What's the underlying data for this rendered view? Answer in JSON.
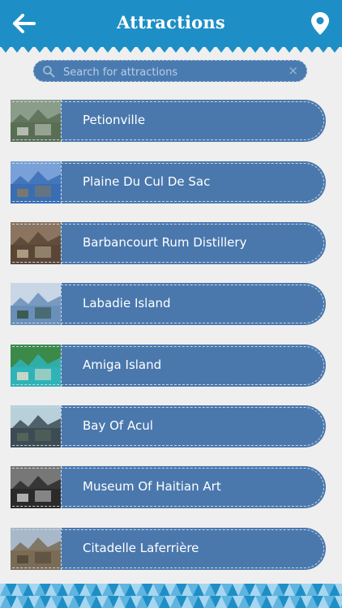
{
  "header": {
    "title": "Attractions",
    "back_icon": "arrow-left-icon",
    "location_icon": "map-pin-icon",
    "color": "#1e8fc6"
  },
  "search": {
    "placeholder": "Search for attractions",
    "value": "",
    "icon": "search-icon",
    "clear_icon": "clear-icon"
  },
  "attractions": [
    {
      "name": "Petionville",
      "thumb_colors": [
        "#5a6e55",
        "#8a9c8a",
        "#c9cfc4"
      ]
    },
    {
      "name": "Plaine Du Cul De Sac",
      "thumb_colors": [
        "#3a6fb5",
        "#7aa0d8",
        "#8a7a5a"
      ]
    },
    {
      "name": "Barbancourt Rum Distillery",
      "thumb_colors": [
        "#5b4636",
        "#8b7560",
        "#c0b095"
      ]
    },
    {
      "name": "Labadie Island",
      "thumb_colors": [
        "#6a8fb8",
        "#c8d6e6",
        "#2f4f3a"
      ]
    },
    {
      "name": "Amiga Island",
      "thumb_colors": [
        "#2fb3b8",
        "#3c8a4a",
        "#e8e0c8"
      ]
    },
    {
      "name": "Bay Of Acul",
      "thumb_colors": [
        "#3d4c55",
        "#b8d0da",
        "#5a6a5a"
      ]
    },
    {
      "name": "Museum Of Haitian Art",
      "thumb_colors": [
        "#2a2a2a",
        "#777777",
        "#cfcfcf"
      ]
    },
    {
      "name": "Citadelle Laferrière",
      "thumb_colors": [
        "#7a6b55",
        "#a8b8c8",
        "#4f4436"
      ]
    }
  ],
  "footer": {
    "pattern": "blue-triangle-pattern",
    "colors": [
      "#1e8fc6",
      "#5fb4e0",
      "#a6d6f0"
    ]
  }
}
